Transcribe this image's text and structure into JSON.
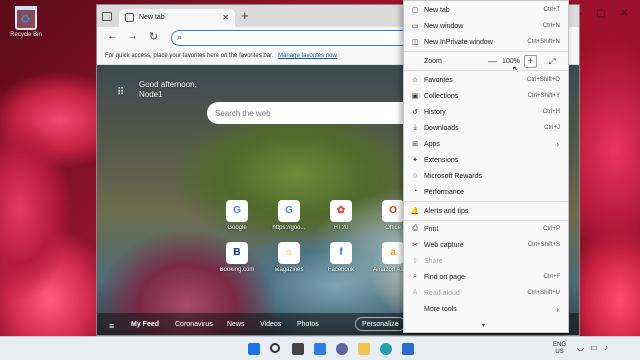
{
  "desktop": {
    "recycle_bin_label": "Recycle Bin"
  },
  "browser": {
    "tab_title": "New tab",
    "tab_close": "✕",
    "new_tab_button": "+",
    "address_placeholder": "",
    "favorites_bar_text": "For quick access, place your favorites here on the favorites bar.",
    "favorites_bar_link": "Manage favorites now"
  },
  "ntp": {
    "greeting_line1": "Good afternoon,",
    "greeting_line2": "Node1",
    "search_placeholder": "Search the web",
    "tiles": [
      {
        "label": "Google",
        "glyph": "G",
        "color": "#4285f4"
      },
      {
        "label": "https://goo...",
        "glyph": "G",
        "color": "#4285f4"
      },
      {
        "label": "HT20",
        "glyph": "✿",
        "color": "#ea4335"
      },
      {
        "label": "Office",
        "glyph": "O",
        "color": "#d83b01"
      },
      {
        "label": "Booking.com",
        "glyph": "B",
        "color": "#003580"
      },
      {
        "label": "Magazines",
        "glyph": "⌂",
        "color": "#f4b400"
      },
      {
        "label": "Facebook",
        "glyph": "f",
        "color": "#1877f2"
      },
      {
        "label": "Amazon Assi...",
        "glyph": "a",
        "color": "#ff9900"
      }
    ],
    "news_tabs": [
      "My Feed",
      "Coronavirus",
      "News",
      "Videos",
      "Photos"
    ],
    "personalize_label": "Personalize"
  },
  "menu": {
    "items": [
      {
        "label": "New tab",
        "shortcut": "Ctrl+T",
        "icon": "new-tab-icon",
        "glyph": "▢"
      },
      {
        "label": "New window",
        "shortcut": "Ctrl+N",
        "icon": "new-window-icon",
        "glyph": "▭"
      },
      {
        "label": "New InPrivate window",
        "shortcut": "Ctrl+Shift+N",
        "icon": "inprivate-icon",
        "glyph": "◫"
      },
      {
        "label": "Zoom",
        "icon": "zoom-icon"
      },
      {
        "label": "Favorites",
        "shortcut": "Ctrl+Shift+O",
        "icon": "favorites-icon",
        "glyph": "☆"
      },
      {
        "label": "Collections",
        "shortcut": "Ctrl+Shift+Y",
        "icon": "collections-icon",
        "glyph": "▣"
      },
      {
        "label": "History",
        "shortcut": "Ctrl+H",
        "icon": "history-icon",
        "glyph": "↺"
      },
      {
        "label": "Downloads",
        "shortcut": "Ctrl+J",
        "icon": "downloads-icon",
        "glyph": "⤓"
      },
      {
        "label": "Apps",
        "icon": "apps-icon",
        "glyph": "⊞",
        "submenu": "›"
      },
      {
        "label": "Extensions",
        "icon": "extensions-icon",
        "glyph": "✦"
      },
      {
        "label": "Microsoft Rewards",
        "icon": "rewards-icon",
        "glyph": "♢"
      },
      {
        "label": "Performance",
        "icon": "performance-icon",
        "glyph": "◔"
      },
      {
        "label": "Alerts and tips",
        "icon": "alerts-icon",
        "glyph": "🔔"
      },
      {
        "label": "Print",
        "shortcut": "Ctrl+P",
        "icon": "print-icon",
        "glyph": "⎙"
      },
      {
        "label": "Web capture",
        "shortcut": "Ctrl+Shift+S",
        "icon": "web-capture-icon",
        "glyph": "✂"
      },
      {
        "label": "Share",
        "icon": "share-icon",
        "glyph": "⇪",
        "disabled": true
      },
      {
        "label": "Find on page",
        "shortcut": "Ctrl+F",
        "icon": "find-icon",
        "glyph": "⌕"
      },
      {
        "label": "Read aloud",
        "shortcut": "Ctrl+Shift+U",
        "icon": "read-aloud-icon",
        "glyph": "A",
        "disabled": true
      },
      {
        "label": "More tools",
        "icon": "more-tools-icon",
        "glyph": "⋯",
        "submenu": "›"
      }
    ],
    "zoom_minus": "—",
    "zoom_value": "100%",
    "zoom_plus": "+",
    "zoom_fullscreen": "⤢",
    "more_indicator": "▾"
  },
  "taskbar": {
    "lang_top": "ENG",
    "lang_bottom": "US",
    "icons": [
      {
        "name": "start-icon",
        "color": "#1a73e8"
      },
      {
        "name": "search-icon",
        "color": "#333333"
      },
      {
        "name": "task-view-icon",
        "color": "#333333"
      },
      {
        "name": "widgets-icon",
        "color": "#2a7de1"
      },
      {
        "name": "chat-icon",
        "color": "#6264a7"
      },
      {
        "name": "file-explorer-icon",
        "color": "#f2c14e"
      },
      {
        "name": "edge-icon",
        "color": "#1fa2a8"
      },
      {
        "name": "store-icon",
        "color": "#2b6cd3"
      }
    ]
  }
}
